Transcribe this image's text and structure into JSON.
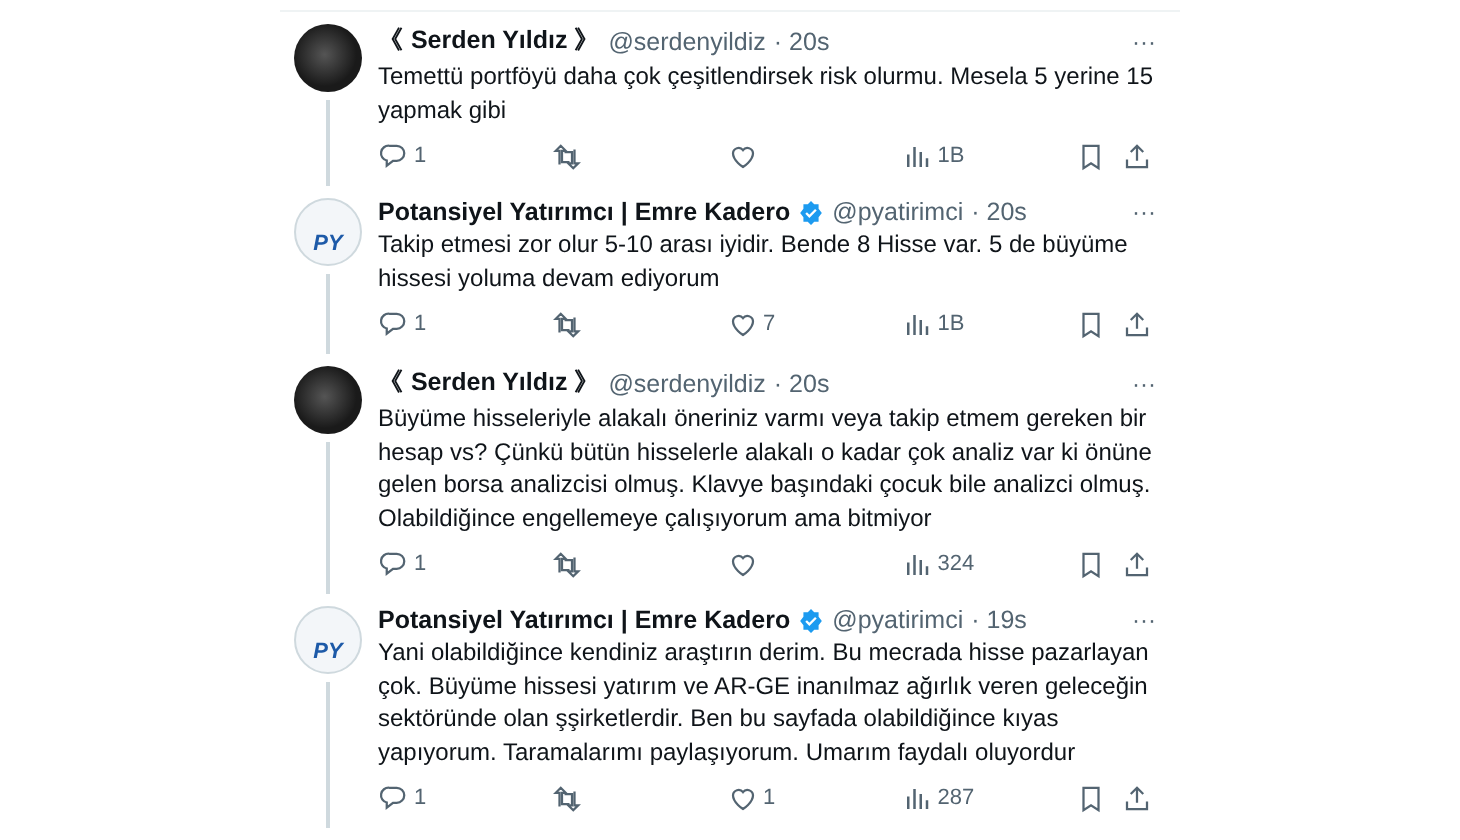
{
  "tweets": [
    {
      "name": "《 Serden Yıldız 》",
      "handle": "@serdenyildiz",
      "time": "· 20s",
      "verified": false,
      "kind": "photo",
      "text": "Temettü portföyü daha çok çeşitlendirsek risk olurmu. Mesela 5 yerine 15 yapmak gibi",
      "more": "···",
      "replies": "1",
      "views": "1B"
    },
    {
      "name": "Potansiyel Yatırımcı | Emre Kadero",
      "handle": "@pyatirimci",
      "time": "· 20s",
      "verified": true,
      "kind": "logo",
      "avatar_text": "PY",
      "text": "Takip etmesi zor olur 5-10 arası iyidir. Bende 8 Hisse var. 5 de büyüme hissesi yoluma devam ediyorum",
      "more": "···",
      "replies": "1",
      "likes": "7",
      "views": "1B"
    },
    {
      "name": "《 Serden Yıldız 》",
      "handle": "@serdenyildiz",
      "time": "· 20s",
      "verified": false,
      "kind": "photo",
      "text": "Büyüme hisseleriyle alakalı öneriniz varmı veya takip etmem gereken bir hesap vs? Çünkü bütün hisselerle alakalı o kadar çok analiz var ki önüne gelen borsa analizcisi olmuş. Klavye başındaki çocuk bile analizci olmuş. Olabildiğince engellemeye çalışıyorum ama bitmiyor",
      "more": "···",
      "replies": "1",
      "views": "324"
    },
    {
      "name": "Potansiyel Yatırımcı | Emre Kadero",
      "handle": "@pyatirimci",
      "time": "· 19s",
      "verified": true,
      "kind": "logo",
      "avatar_text": "PY",
      "text": "Yani olabildiğince kendiniz araştırın derim. Bu mecrada hisse pazarlayan çok. Büyüme hissesi yatırım ve AR-GE inanılmaz ağırlık veren geleceğin sektöründe olan şşirketlerdir. Ben bu sayfada olabildiğince kıyas yapıyorum. Taramalarımı paylaşıyorum. Umarım faydalı oluyordur",
      "more": "···",
      "replies": "1",
      "likes": "1",
      "views": "287"
    }
  ]
}
